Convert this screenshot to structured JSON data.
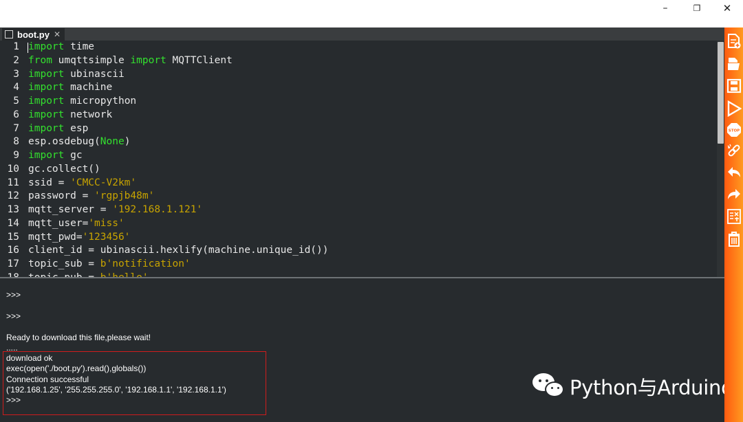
{
  "window": {
    "minimize_glyph": "–",
    "maximize_glyph": "❐",
    "close_glyph": "✕"
  },
  "tab": {
    "label": "boot.py",
    "close_glyph": "✕"
  },
  "editor": {
    "lines": [
      {
        "n": "1",
        "segs": [
          {
            "t": "import",
            "c": "kw"
          },
          {
            "t": " time",
            "c": ""
          }
        ]
      },
      {
        "n": "2",
        "segs": [
          {
            "t": "from",
            "c": "kw"
          },
          {
            "t": " umqttsimple ",
            "c": ""
          },
          {
            "t": "import",
            "c": "kw"
          },
          {
            "t": " MQTTClient",
            "c": ""
          }
        ]
      },
      {
        "n": "3",
        "segs": [
          {
            "t": "import",
            "c": "kw"
          },
          {
            "t": " ubinascii",
            "c": ""
          }
        ]
      },
      {
        "n": "4",
        "segs": [
          {
            "t": "import",
            "c": "kw"
          },
          {
            "t": " machine",
            "c": ""
          }
        ]
      },
      {
        "n": "5",
        "segs": [
          {
            "t": "import",
            "c": "kw"
          },
          {
            "t": " micropython",
            "c": ""
          }
        ]
      },
      {
        "n": "6",
        "segs": [
          {
            "t": "import",
            "c": "kw"
          },
          {
            "t": " network",
            "c": ""
          }
        ]
      },
      {
        "n": "7",
        "segs": [
          {
            "t": "import",
            "c": "kw"
          },
          {
            "t": " esp",
            "c": ""
          }
        ]
      },
      {
        "n": "8",
        "segs": [
          {
            "t": "esp.osdebug(",
            "c": ""
          },
          {
            "t": "None",
            "c": "kw"
          },
          {
            "t": ")",
            "c": ""
          }
        ]
      },
      {
        "n": "9",
        "segs": [
          {
            "t": "import",
            "c": "kw"
          },
          {
            "t": " gc",
            "c": ""
          }
        ]
      },
      {
        "n": "10",
        "segs": [
          {
            "t": "gc.collect()",
            "c": ""
          }
        ]
      },
      {
        "n": "11",
        "segs": [
          {
            "t": "ssid = ",
            "c": ""
          },
          {
            "t": "'CMCC-V2km'",
            "c": "str"
          }
        ]
      },
      {
        "n": "12",
        "segs": [
          {
            "t": "password = ",
            "c": ""
          },
          {
            "t": "'rgpjb48m'",
            "c": "str"
          }
        ]
      },
      {
        "n": "13",
        "segs": [
          {
            "t": "mqtt_server = ",
            "c": ""
          },
          {
            "t": "'192.168.1.121'",
            "c": "str"
          }
        ]
      },
      {
        "n": "14",
        "segs": [
          {
            "t": "mqtt_user=",
            "c": ""
          },
          {
            "t": "'miss'",
            "c": "str"
          }
        ]
      },
      {
        "n": "15",
        "segs": [
          {
            "t": "mqtt_pwd=",
            "c": ""
          },
          {
            "t": "'123456'",
            "c": "str"
          }
        ]
      },
      {
        "n": "16",
        "segs": [
          {
            "t": "client_id = ubinascii.hexlify(machine.unique_id())",
            "c": ""
          }
        ]
      },
      {
        "n": "17",
        "segs": [
          {
            "t": "topic_sub = ",
            "c": ""
          },
          {
            "t": "b'notification'",
            "c": "str"
          }
        ]
      },
      {
        "n": "18",
        "segs": [
          {
            "t": "topic_pub = ",
            "c": ""
          },
          {
            "t": "b'hello'",
            "c": "str"
          }
        ]
      }
    ]
  },
  "console": {
    "prompt1": ">>>",
    "prompt2": ">>>",
    "ready": "Ready to download this file,please wait!",
    "dots": ".....",
    "download_ok": "download ok",
    "exec": "exec(open('./boot.py').read(),globals())",
    "connection": "Connection successful",
    "ifconfig": "('192.168.1.25', '255.255.255.0', '192.168.1.1', '192.168.1.1')",
    "prompt3": ">>>"
  },
  "watermark": {
    "text": "Python与Arduino"
  },
  "toolbar": {
    "accent": "#ff7a18",
    "tools": [
      "new-file-icon",
      "open-folder-icon",
      "save-icon",
      "run-icon",
      "stop-icon",
      "connect-icon",
      "undo-icon",
      "redo-icon",
      "syntax-check-icon",
      "clear-icon"
    ]
  }
}
